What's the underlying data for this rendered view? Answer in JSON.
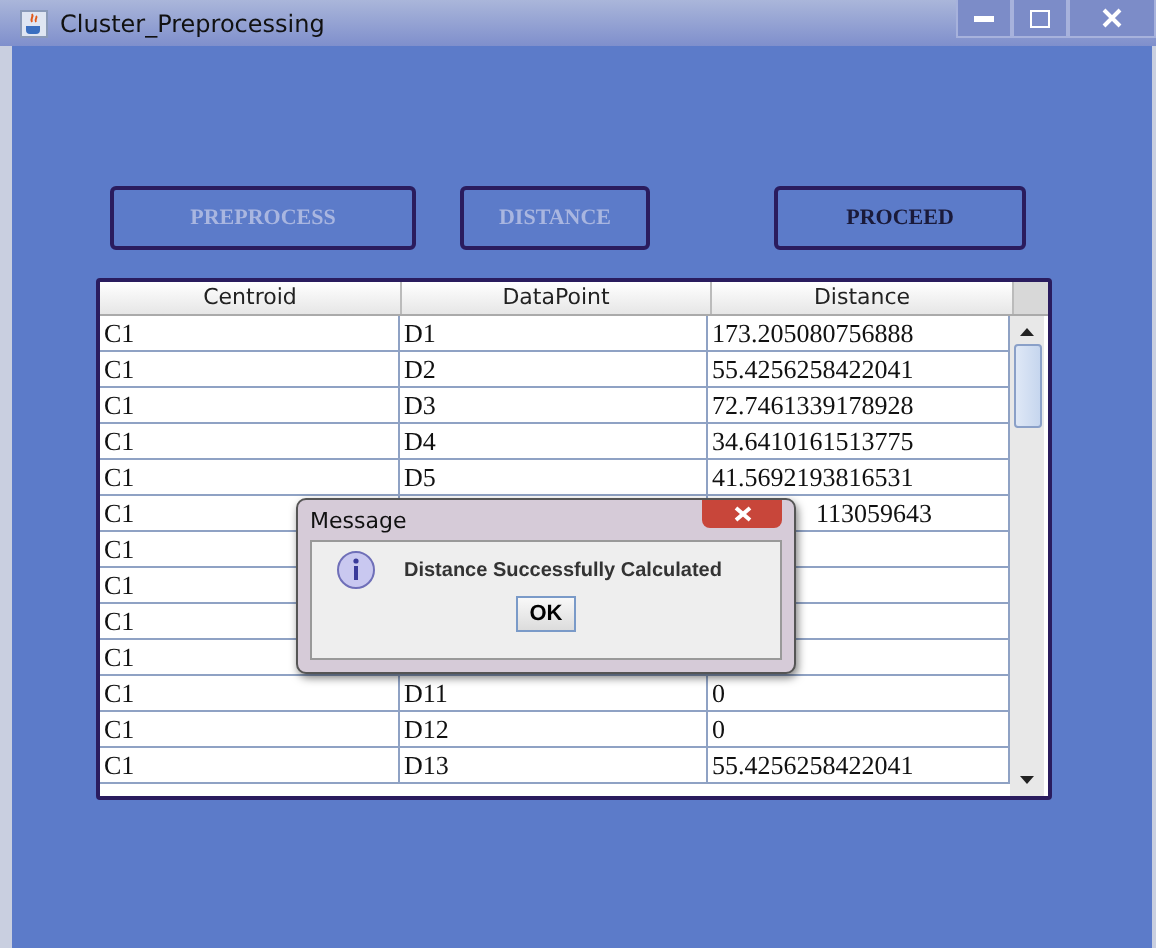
{
  "window": {
    "title": "Cluster_Preprocessing"
  },
  "buttons": [
    {
      "label": "PREPROCESS",
      "disabled": true
    },
    {
      "label": "DISTANCE",
      "disabled": true
    },
    {
      "label": "PROCEED",
      "disabled": false
    }
  ],
  "table": {
    "columns": [
      "Centroid",
      "DataPoint",
      "Distance"
    ],
    "rows": [
      {
        "centroid": "C1",
        "datapoint": "D1",
        "distance": "173.205080756888"
      },
      {
        "centroid": "C1",
        "datapoint": "D2",
        "distance": "55.4256258422041"
      },
      {
        "centroid": "C1",
        "datapoint": "D3",
        "distance": "72.7461339178928"
      },
      {
        "centroid": "C1",
        "datapoint": "D4",
        "distance": "34.6410161513775"
      },
      {
        "centroid": "C1",
        "datapoint": "D5",
        "distance": "41.5692193816531"
      },
      {
        "centroid": "C1",
        "distance": "113059643",
        "covered": true
      },
      {
        "centroid": "C1"
      },
      {
        "centroid": "C1"
      },
      {
        "centroid": "C1"
      },
      {
        "centroid": "C1"
      },
      {
        "centroid": "C1",
        "datapoint": "D11",
        "distance": "0"
      },
      {
        "centroid": "C1",
        "datapoint": "D12",
        "distance": "0"
      },
      {
        "centroid": "C1",
        "datapoint": "D13",
        "distance": "55.4256258422041"
      }
    ]
  },
  "dialog": {
    "title": "Message",
    "message": "Distance Successfully Calculated",
    "button": "OK"
  }
}
